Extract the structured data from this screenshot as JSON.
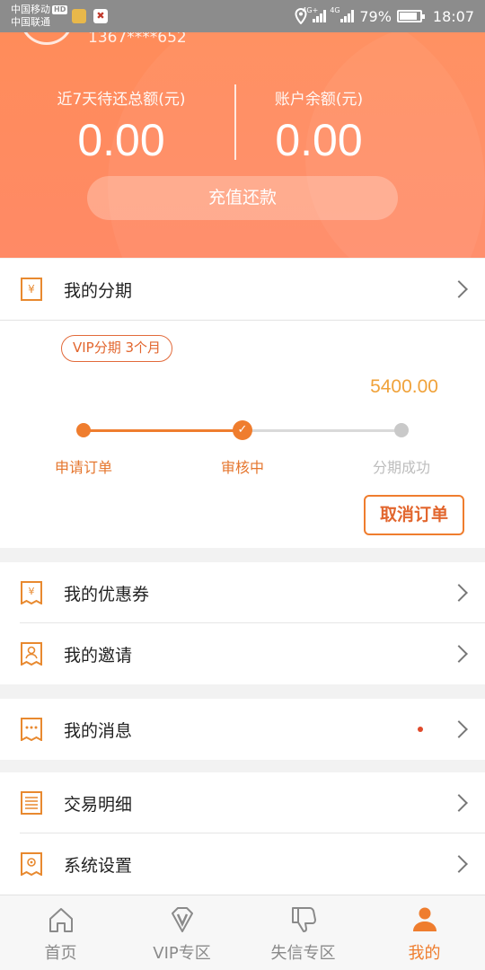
{
  "status_bar": {
    "carrier1": "中国移动",
    "hd": "HD",
    "carrier2": "中国联通",
    "net1": "4G+",
    "net2": "4G",
    "battery": "79%",
    "time": "18:07"
  },
  "header": {
    "phone": "1367****652",
    "due_label": "近7天待还总额(元)",
    "due_value": "0.00",
    "balance_label": "账户余额(元)",
    "balance_value": "0.00",
    "recharge_label": "充值还款"
  },
  "installment": {
    "title": "我的分期",
    "tag": "VIP分期 3个月",
    "amount": "5400.00",
    "steps": [
      "申请订单",
      "审核中",
      "分期成功"
    ],
    "cancel_label": "取消订单"
  },
  "menu": {
    "coupons": "我的优惠券",
    "invite": "我的邀请",
    "messages": "我的消息",
    "transactions": "交易明细",
    "settings": "系统设置"
  },
  "nav": {
    "items": [
      {
        "label": "首页",
        "icon": "home-icon"
      },
      {
        "label": "VIP专区",
        "icon": "vip-icon"
      },
      {
        "label": "失信专区",
        "icon": "thumbs-down-icon"
      },
      {
        "label": "我的",
        "icon": "user-icon"
      }
    ],
    "active_index": 3
  },
  "colors": {
    "accent": "#ef7d2e",
    "header": "#ff8a5e",
    "amount": "#f0a23a"
  }
}
